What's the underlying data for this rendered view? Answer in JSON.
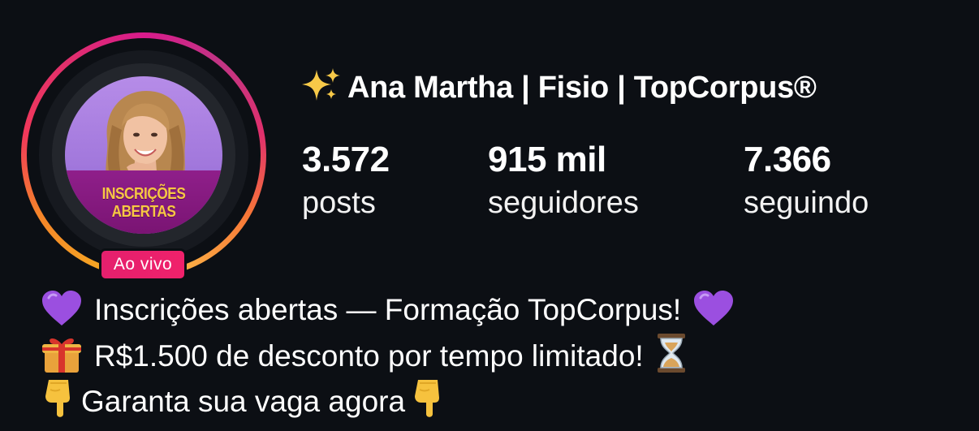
{
  "profile": {
    "name": "Ana Martha | Fisio | TopCorpus®",
    "name_icon": "sparkles-icon",
    "avatar_banner": [
      "INSCRIÇÕES",
      "ABERTAS"
    ],
    "live_badge": "Ao vivo",
    "colors": {
      "background": "#0c0f14",
      "live_badge": "#e4206d",
      "banner": "#8f1f8a",
      "banner_text": "#f6c744"
    }
  },
  "stats": {
    "posts": {
      "value": "3.572",
      "label": "posts"
    },
    "followers": {
      "value": "915 mil",
      "label": "seguidores"
    },
    "following": {
      "value": "7.366",
      "label": "seguindo"
    }
  },
  "bio": {
    "line1": {
      "icon_start": "purple-heart-icon",
      "text": "Inscrições abertas — Formação TopCorpus!",
      "icon_end": "purple-heart-icon"
    },
    "line2": {
      "icon_start": "gift-icon",
      "text": "R$1.500 de desconto por tempo limitado!",
      "icon_end": "hourglass-icon"
    },
    "line3": {
      "icon_start": "pointing-down-icon",
      "text": "Garanta sua vaga agora",
      "icon_end": "pointing-down-icon"
    }
  }
}
